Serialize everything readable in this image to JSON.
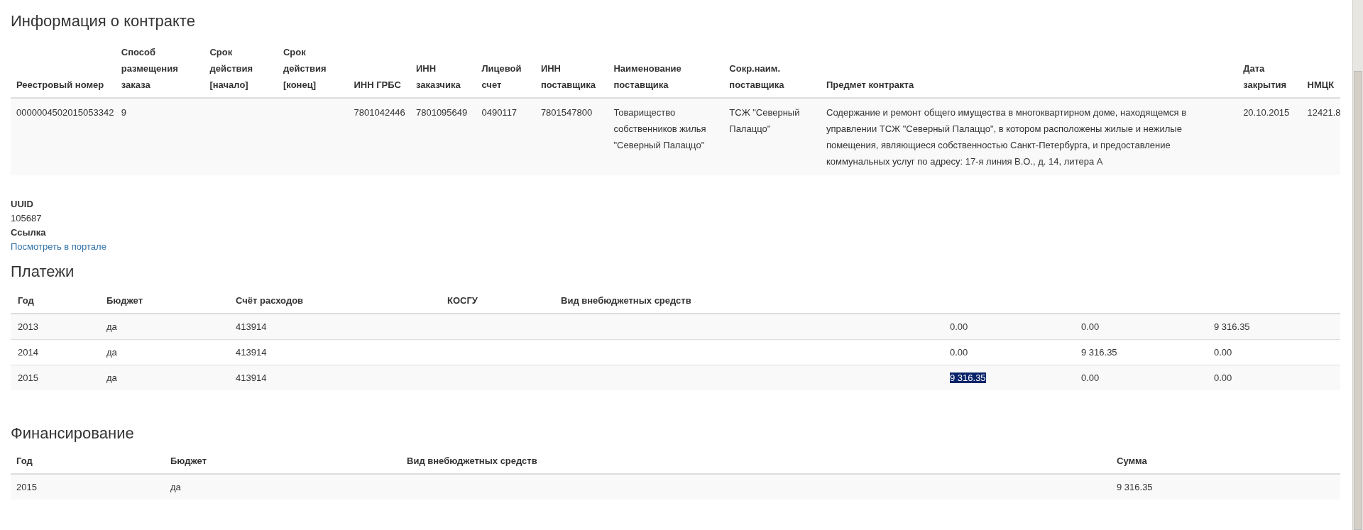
{
  "contract": {
    "title": "Информация о контракте",
    "columns": [
      "Реестровый номер",
      "Способ размещения заказа",
      "Срок действия [начало]",
      "Срок действия [конец]",
      "ИНН ГРБС",
      "ИНН заказчика",
      "Лицевой счет",
      "ИНН поставщика",
      "Наименование поставщика",
      "Сокр.наим. поставщика",
      "Предмет контракта",
      "Дата закрытия",
      "НМЦК"
    ],
    "rows": [
      [
        "0000004502015053342",
        "9",
        null,
        null,
        "7801042446",
        "7801095649",
        "0490117",
        "7801547800",
        "Товарищество собственников жилья \"Северный Палаццо\"",
        "ТСЖ \"Северный Палаццо\"",
        "Содержание и ремонт общего имущества в многоквартирном доме, находящемся в управлении ТСЖ \"Северный Палаццо\", в котором расположены жилые и нежилые помещения, являющиеся собственностью Санкт-Петербурга, и предоставление коммунальных услуг по адресу: 17-я линия В.О., д. 14, литера А",
        "20.10.2015",
        "12421.8"
      ]
    ]
  },
  "details": [
    {
      "label": "UUID",
      "value": "105687",
      "kind": "text"
    },
    {
      "label": "Ссылка",
      "value": "Посмотреть в портале",
      "kind": "link"
    }
  ],
  "payments": {
    "title": "Платежи",
    "columns": [
      "Год",
      "Бюджет",
      "Счёт расходов",
      "КОСГУ",
      "Вид внебюджетных средств",
      null,
      null,
      null
    ],
    "rows": [
      [
        {
          "text": "2013",
          "selected": false
        },
        {
          "text": "да",
          "selected": false
        },
        {
          "text": "413914",
          "selected": false
        },
        null,
        null,
        {
          "text": "0.00",
          "selected": false
        },
        {
          "text": "0.00",
          "selected": false
        },
        {
          "text": "9 316.35",
          "selected": false
        }
      ],
      [
        {
          "text": "2014",
          "selected": false
        },
        {
          "text": "да",
          "selected": false
        },
        {
          "text": "413914",
          "selected": false
        },
        null,
        null,
        {
          "text": "0.00",
          "selected": false
        },
        {
          "text": "9 316.35",
          "selected": false
        },
        {
          "text": "0.00",
          "selected": false
        }
      ],
      [
        {
          "text": "2015",
          "selected": false
        },
        {
          "text": "да",
          "selected": false
        },
        {
          "text": "413914",
          "selected": false
        },
        null,
        null,
        {
          "text": "9 316.35",
          "selected": true
        },
        {
          "text": "0.00",
          "selected": false
        },
        {
          "text": "0.00",
          "selected": false
        }
      ]
    ]
  },
  "financing": {
    "title": "Финансирование",
    "columns": [
      "Год",
      "Бюджет",
      "Вид внебюджетных средств",
      "Сумма"
    ],
    "rows": [
      [
        "2015",
        "да",
        null,
        "9 316.35"
      ]
    ]
  }
}
